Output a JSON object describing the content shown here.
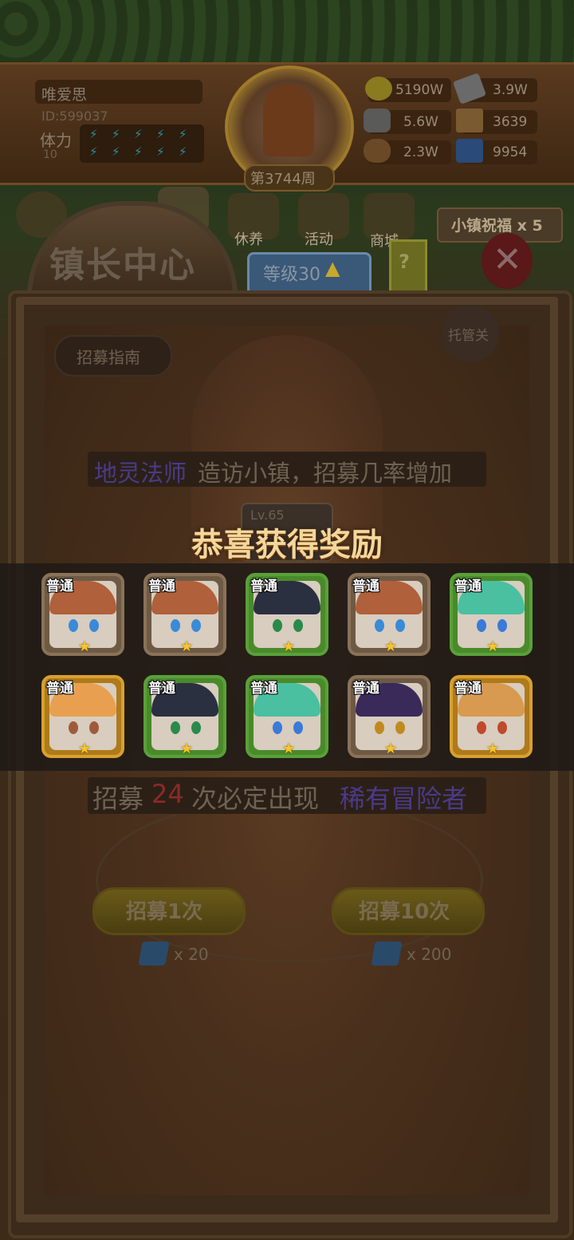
{
  "player": {
    "name": "唯爱思",
    "id": "ID:599037",
    "stamina_label": "体力",
    "stamina_value": "10"
  },
  "portrait": {
    "week": "第3744周"
  },
  "resources": [
    {
      "icon": "gold-coin-icon",
      "value": "5190W"
    },
    {
      "icon": "iron-ingot-icon",
      "value": "3.9W"
    },
    {
      "icon": "stone-icon",
      "value": "5.6W"
    },
    {
      "icon": "wood-plank-icon",
      "value": "3639"
    },
    {
      "icon": "log-icon",
      "value": "2.3W"
    },
    {
      "icon": "blue-gem-icon",
      "value": "9954"
    }
  ],
  "nav": {
    "rest": "休养",
    "activity": "活动",
    "shop": "商城",
    "blessing": "小镇祝福 x 5"
  },
  "panel": {
    "title": "镇长中心",
    "level": "等级30",
    "help": "?",
    "guide": "招募指南",
    "auto": "托管关",
    "hero_level": "Lv.65",
    "visit_highlight": "地灵法师",
    "visit_text": "造访小镇，招募几率增加",
    "guarantee_prefix": "招募",
    "guarantee_count": "24",
    "guarantee_mid": "次必定出现",
    "guarantee_rare": "稀有冒险者",
    "recruit_one": "招募1次",
    "recruit_one_cost": "x 20",
    "recruit_ten": "招募10次",
    "recruit_ten_cost": "x 200"
  },
  "reward": {
    "title": "恭喜获得奖励",
    "cards": [
      {
        "rarity": "普通",
        "frame": "brown",
        "hair": "#b0603a",
        "eyes": "#3a8ad8",
        "stars": 1
      },
      {
        "rarity": "普通",
        "frame": "brown",
        "hair": "#b0603a",
        "eyes": "#3a8ad8",
        "stars": 1
      },
      {
        "rarity": "普通",
        "frame": "green",
        "hair": "#2a3040",
        "eyes": "#2a8a4a",
        "stars": 1
      },
      {
        "rarity": "普通",
        "frame": "brown",
        "hair": "#b0603a",
        "eyes": "#3a8ad8",
        "stars": 1
      },
      {
        "rarity": "普通",
        "frame": "green",
        "hair": "#4ac0a0",
        "eyes": "#3a7ad8",
        "stars": 1
      },
      {
        "rarity": "普通",
        "frame": "gold",
        "hair": "#e8a050",
        "eyes": "#a05a3a",
        "stars": 1
      },
      {
        "rarity": "普通",
        "frame": "green",
        "hair": "#2a3040",
        "eyes": "#2a8a4a",
        "stars": 1
      },
      {
        "rarity": "普通",
        "frame": "green",
        "hair": "#4ac0a0",
        "eyes": "#3a7ad8",
        "stars": 1
      },
      {
        "rarity": "普通",
        "frame": "brown",
        "hair": "#3a2a5a",
        "eyes": "#c08a20",
        "stars": 1
      },
      {
        "rarity": "普通",
        "frame": "gold",
        "hair": "#d89a50",
        "eyes": "#c04a2a",
        "stars": 1
      }
    ]
  },
  "colors": {
    "accent_gold": "#f4d79a",
    "rare_purple": "#4a3a8a",
    "count_red": "#8a2a2a"
  }
}
